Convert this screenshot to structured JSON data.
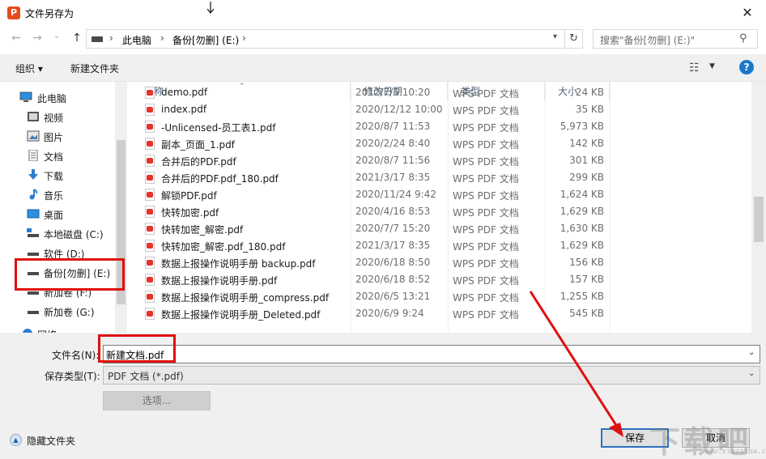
{
  "window": {
    "title": "文件另存为",
    "app_icon_letter": "P",
    "close_glyph": "✕"
  },
  "navbar": {
    "back_glyph": "←",
    "forward_glyph": "→",
    "recent_glyph": "⌄",
    "up_glyph": "↑",
    "breadcrumb": [
      "此电脑",
      "备份[勿删] (E:)"
    ],
    "separator": "›",
    "refresh_glyph": "↻",
    "search_placeholder": "搜索\"备份[勿删] (E:)\""
  },
  "toolbar": {
    "organize_label": "组织 ▾",
    "new_folder_label": "新建文件夹",
    "help_glyph": "?"
  },
  "nav_pane": {
    "items": [
      {
        "label": "此电脑",
        "icon": "computer-icon",
        "indent": 0
      },
      {
        "label": "视频",
        "icon": "video-icon",
        "indent": 1
      },
      {
        "label": "图片",
        "icon": "pictures-icon",
        "indent": 1
      },
      {
        "label": "文档",
        "icon": "documents-icon",
        "indent": 1
      },
      {
        "label": "下载",
        "icon": "downloads-icon",
        "indent": 1
      },
      {
        "label": "音乐",
        "icon": "music-icon",
        "indent": 1
      },
      {
        "label": "桌面",
        "icon": "desktop-icon",
        "indent": 1
      },
      {
        "label": "本地磁盘 (C:)",
        "icon": "drive-icon",
        "indent": 1
      },
      {
        "label": "软件 (D:)",
        "icon": "drive-icon",
        "indent": 1
      },
      {
        "label": "备份[勿删] (E:)",
        "icon": "drive-icon",
        "indent": 1,
        "selected": true
      },
      {
        "label": "新加卷 (F:)",
        "icon": "drive-icon",
        "indent": 1
      },
      {
        "label": "新加卷 (G:)",
        "icon": "drive-icon",
        "indent": 1
      },
      {
        "label": "网络",
        "icon": "network-icon",
        "indent": 0
      }
    ]
  },
  "file_list": {
    "columns": {
      "name": "名称",
      "date": "修改日期",
      "type": "类型",
      "size": "大小"
    },
    "rows": [
      {
        "name": "demo.pdf",
        "date": "2012/7/5 10:20",
        "type": "WPS PDF 文档",
        "size": "24 KB"
      },
      {
        "name": "index.pdf",
        "date": "2020/12/12 10:00",
        "type": "WPS PDF 文档",
        "size": "35 KB"
      },
      {
        "name": "-Unlicensed-员工表1.pdf",
        "date": "2020/8/7 11:53",
        "type": "WPS PDF 文档",
        "size": "5,973 KB"
      },
      {
        "name": "副本_页面_1.pdf",
        "date": "2020/2/24 8:40",
        "type": "WPS PDF 文档",
        "size": "142 KB"
      },
      {
        "name": "合并后的PDF.pdf",
        "date": "2020/8/7 11:56",
        "type": "WPS PDF 文档",
        "size": "301 KB"
      },
      {
        "name": "合并后的PDF.pdf_180.pdf",
        "date": "2021/3/17 8:35",
        "type": "WPS PDF 文档",
        "size": "299 KB"
      },
      {
        "name": "解锁PDF.pdf",
        "date": "2020/11/24 9:42",
        "type": "WPS PDF 文档",
        "size": "1,624 KB"
      },
      {
        "name": "快转加密.pdf",
        "date": "2020/4/16 8:53",
        "type": "WPS PDF 文档",
        "size": "1,629 KB"
      },
      {
        "name": "快转加密_解密.pdf",
        "date": "2020/7/7 15:20",
        "type": "WPS PDF 文档",
        "size": "1,630 KB"
      },
      {
        "name": "快转加密_解密.pdf_180.pdf",
        "date": "2021/3/17 8:35",
        "type": "WPS PDF 文档",
        "size": "1,629 KB"
      },
      {
        "name": "数据上报操作说明手册 backup.pdf",
        "date": "2020/6/18 8:50",
        "type": "WPS PDF 文档",
        "size": "156 KB"
      },
      {
        "name": "数据上报操作说明手册.pdf",
        "date": "2020/6/18 8:52",
        "type": "WPS PDF 文档",
        "size": "157 KB"
      },
      {
        "name": "数据上报操作说明手册_compress.pdf",
        "date": "2020/6/5 13:21",
        "type": "WPS PDF 文档",
        "size": "1,255 KB"
      },
      {
        "name": "数据上报操作说明手册_Deleted.pdf",
        "date": "2020/6/9 9:24",
        "type": "WPS PDF 文档",
        "size": "545 KB"
      }
    ]
  },
  "form": {
    "filename_label": "文件名(N):",
    "filename_value": "新建文档.pdf",
    "filetype_label": "保存类型(T):",
    "filetype_value": "PDF 文档 (*.pdf)",
    "options_label": "选项...",
    "hide_folders_label": "隐藏文件夹",
    "save_label": "保存",
    "cancel_label": "取消"
  },
  "watermark": {
    "text": "下载吧",
    "sub": "www.xiazaiba.com"
  },
  "colors": {
    "annotation_red": "#e01010",
    "accent_blue": "#2b6fc0",
    "pdf_red": "#e2342d"
  }
}
